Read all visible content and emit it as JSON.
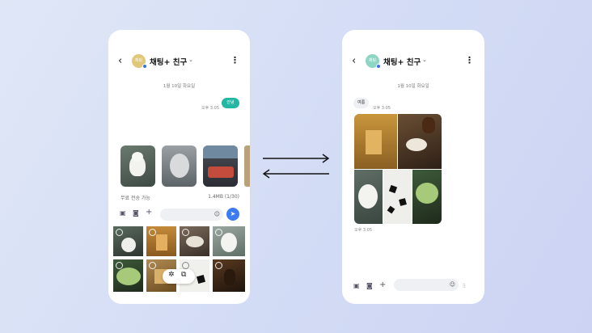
{
  "left_phone": {
    "header": {
      "back": "‹",
      "avatar_text": "채팅",
      "title": "채팅+ 친구",
      "chevron": "⌄",
      "more": "⋮"
    },
    "date": "1월 10일 화요일",
    "sent_message": {
      "text": "안녕",
      "time": "오후 3:05"
    },
    "attachments": {
      "free_transfer_label": "무료 전송 가능",
      "size_count": "1.4MB (1/30)"
    },
    "input": {
      "gallery_icon": "▣",
      "camera_icon": "◙",
      "add_icon": "+",
      "emoji_icon": "☺",
      "send_icon": "➤"
    },
    "floating": {
      "sparkle_icon": "✲",
      "layout_icon": "⧉"
    }
  },
  "right_phone": {
    "header": {
      "back": "‹",
      "avatar_text": "채팅",
      "title": "채팅+ 친구",
      "chevron": "⌄",
      "more": "⋮"
    },
    "date": "1월 10일 화요일",
    "received": {
      "sender": "여름",
      "time_top": "오후 3:05",
      "time_bottom": "오후 3:05"
    },
    "input": {
      "gallery_icon": "▣",
      "camera_icon": "◙",
      "add_icon": "+",
      "emoji_icon": "☺",
      "voice_icon": "⫶⫶"
    }
  },
  "colors": {
    "accent_teal": "#21b7a2",
    "send_blue": "#3b7cf0",
    "avatar_left": "#e0c77a",
    "avatar_right": "#8fd5c4"
  }
}
